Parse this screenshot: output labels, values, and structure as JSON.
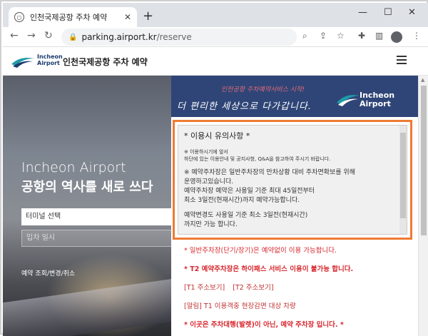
{
  "browser": {
    "tab_title": "인천국제공항 주차 예약",
    "url_domain": "parking.airport.kr",
    "url_path": "/reserve"
  },
  "site": {
    "logo_line1": "Incheon",
    "logo_line2": "Airport",
    "title": "인천국제공항 주차 예약"
  },
  "hero": {
    "title_en": "Incheon Airport",
    "title_ko": "공항의 역사를 새로 쓰다",
    "terminal_select": "터미널 선택",
    "date_placeholder": "입차 일시",
    "reservation_link": "예약 조회/변경/취소"
  },
  "banner": {
    "sub": "인천공항 주차예약서비스 시작!",
    "main": "더 편리한 세상으로 다가갑니다.",
    "logo_line1": "Incheon",
    "logo_line2": "Airport"
  },
  "notice": {
    "heading": "* 이용시 유의사항 *",
    "note1_line1": "※ 이용하시기에 앞서",
    "note1_line2": "하단에 있는 이용안내 및 공지사항, Q&A을 참고하여 주시기 바랍니다.",
    "note2_line1": "※ 예약주차장은 일반주차장의 만차상황 대비 주차면확보를 위해",
    "note2_line2": "운영하고있습니다.",
    "note2_line3": "예약주차장 예약은 사용일 기준 최대 45일전부터",
    "note2_line4": "최소 3일전(현재시간)까지 예약가능합니다.",
    "note3_line1": "예약변경도 사용일 기준 최소 3일전(현재시간)",
    "note3_line2": "까지만 가능 합니다."
  },
  "info": {
    "line1": "* 일반주차장(단기/장기)은 예약없이 이용 가능합니다.",
    "line2": "* T2 예약주차장은 하이패스 서비스 이용이 불가능 합니다.",
    "t1_map": "[T1 주소보기]",
    "t2_map": "[T2 주소보기]",
    "alert": "[알림] T1 이용객중 현장감면 대상 차량",
    "line3": "* 이곳은 주차대행(발렛)이 아닌, 예약 주차장 입니다. *"
  },
  "colors": {
    "accent_orange": "#ef7a33",
    "warning_red": "#d8262c",
    "banner_navy": "#2f4577"
  }
}
